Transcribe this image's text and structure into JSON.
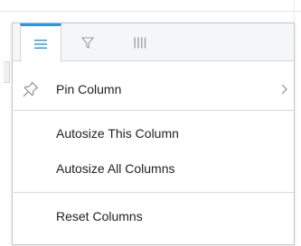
{
  "column_menu": {
    "tabs": [
      {
        "name": "general",
        "icon": "menu-lines-icon",
        "selected": true
      },
      {
        "name": "filter",
        "icon": "filter-funnel-icon",
        "selected": false
      },
      {
        "name": "columns",
        "icon": "columns-bars-icon",
        "selected": false
      }
    ],
    "items": {
      "pin_column": {
        "label": "Pin Column",
        "icon": "pin-icon",
        "has_submenu": true
      },
      "autosize_this": {
        "label": "Autosize This Column"
      },
      "autosize_all": {
        "label": "Autosize All Columns"
      },
      "reset_columns": {
        "label": "Reset Columns"
      }
    }
  },
  "colors": {
    "accent": "#2196f3",
    "tab_bar_bg": "#f5f6f7",
    "border": "#c8c8c8",
    "text": "#222222",
    "icon": "#9a9a9a"
  }
}
